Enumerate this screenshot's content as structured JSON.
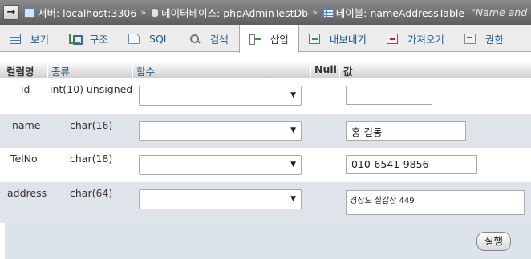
{
  "breadcrumb": {
    "arrow": "→",
    "server": "서버: localhost:3306",
    "database": "데이터베이스: phpAdminTestDb",
    "table": "테이블: nameAddressTable",
    "comment": "\"Name and",
    "separator": "»"
  },
  "tabs": [
    {
      "label": "보기",
      "icon": "browse-icon"
    },
    {
      "label": "구조",
      "icon": "structure-icon"
    },
    {
      "label": "SQL",
      "icon": "sql-icon"
    },
    {
      "label": "검색",
      "icon": "search-icon"
    },
    {
      "label": "삽입",
      "icon": "insert-icon",
      "active": true
    },
    {
      "label": "내보내기",
      "icon": "export-icon"
    },
    {
      "label": "가져오기",
      "icon": "import-icon"
    },
    {
      "label": "권한",
      "icon": "privileges-icon"
    }
  ],
  "headers": {
    "column": "컬럼명",
    "type": "종류",
    "function": "함수",
    "null": "Null",
    "value": "값"
  },
  "rows": [
    {
      "name": "id",
      "type": "int(10) unsigned",
      "value": ""
    },
    {
      "name": "name",
      "type": "char(16)",
      "value": "홍 길동"
    },
    {
      "name": "TelNo",
      "type": "char(18)",
      "value": "010-6541-9856"
    },
    {
      "name": "address",
      "type": "char(64)",
      "value": "경상도 칠갑산 449"
    }
  ],
  "go_button": "실행",
  "colors": {
    "link": "#235a81",
    "row_alt": "#dfe4eb",
    "footer": "#dde3ec"
  }
}
